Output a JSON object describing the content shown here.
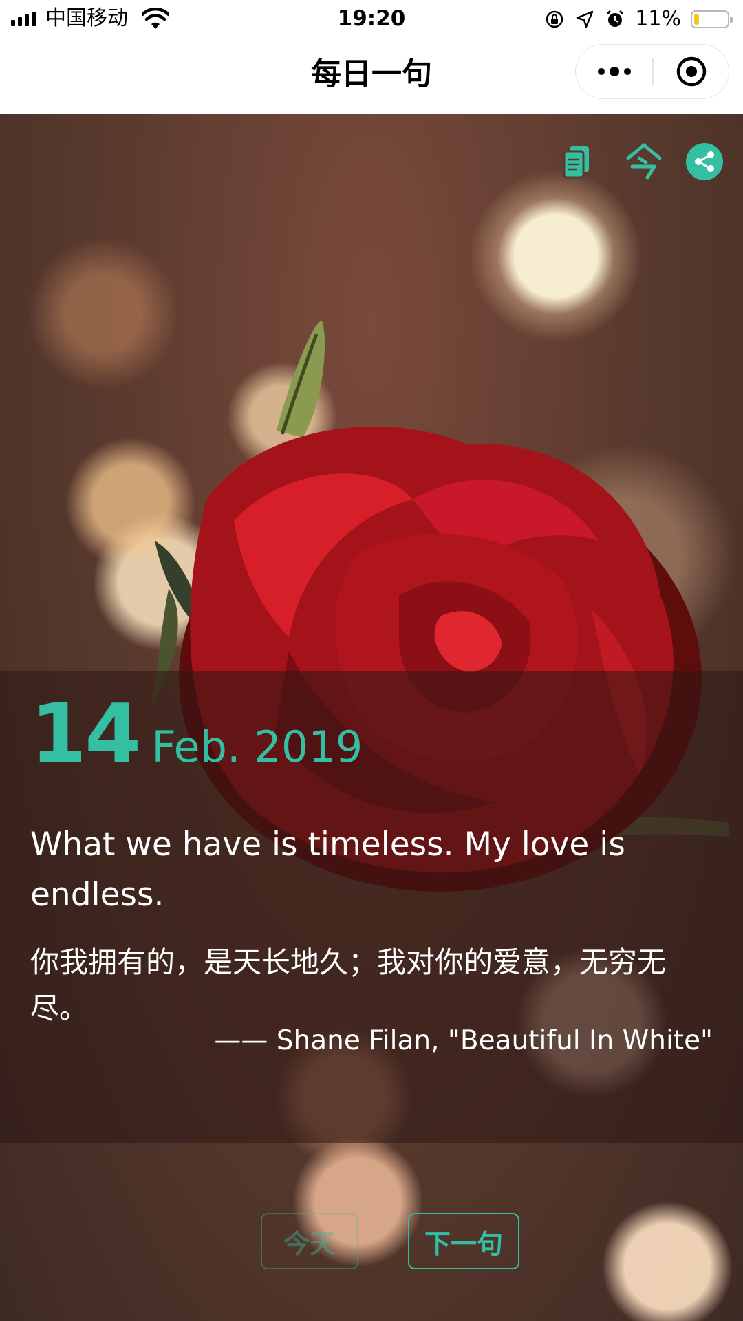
{
  "status_bar": {
    "carrier": "中国移动",
    "time": "19:20",
    "battery_percent_label": "11%",
    "battery_level": 0.11,
    "icons": [
      "signal-icon",
      "wifi-icon",
      "orientation-lock-icon",
      "location-icon",
      "alarm-icon",
      "battery-icon"
    ]
  },
  "nav": {
    "title": "每日一句",
    "more_icon": "more-dots-icon",
    "close_icon": "target-close-icon"
  },
  "toolbar": {
    "icons": [
      "copy-icon",
      "today-icon",
      "share-icon"
    ],
    "accent_color": "#34bfa3"
  },
  "quote": {
    "day": "14",
    "month_year": "Feb. 2019",
    "text_en": "What we have is timeless. My love is endless.",
    "text_zh": "你我拥有的，是天长地久；我对你的爱意，无穷无尽。",
    "source": "—— Shane Filan, \"Beautiful In White\""
  },
  "buttons": {
    "today_label": "今天",
    "next_label": "下一句"
  }
}
